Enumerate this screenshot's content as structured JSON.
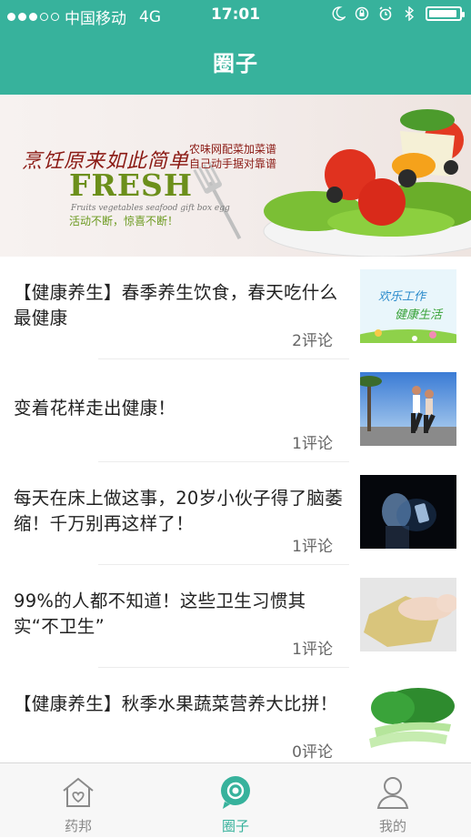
{
  "status_bar": {
    "carrier": "中国移动",
    "network": "4G",
    "time": "17:01",
    "signal_filled": 3,
    "signal_total": 5,
    "battery_level": 0.95,
    "icons": [
      "moon-icon",
      "orientation-lock-icon",
      "alarm-icon",
      "bluetooth-icon",
      "battery-icon"
    ]
  },
  "nav": {
    "title": "圈子"
  },
  "banner": {
    "slogan": "烹饪原来如此简单",
    "side_line1": "农味网配菜加菜谱",
    "side_line2": "自己动手据对靠谱",
    "fresh": "FRESH",
    "sub": "Fruits  vegetables  seafood  gift box egg",
    "tagline": "活动不断，惊喜不断！"
  },
  "posts": [
    {
      "title": "【健康养生】春季养生饮食，春天吃什么最健康",
      "comments": "2评论",
      "thumb": "spring-banner",
      "thumb_text1": "欢乐工作",
      "thumb_text2": "健康生活"
    },
    {
      "title": "变着花样走出健康！",
      "comments": "1评论",
      "thumb": "runners-photo"
    },
    {
      "title": "每天在床上做这事，20岁小伙子得了脑萎缩！千万别再这样了！",
      "comments": "1评论",
      "thumb": "phone-in-dark-photo"
    },
    {
      "title": "99%的人都不知道！这些卫生习惯其实“不卫生”",
      "comments": "1评论",
      "thumb": "cleaning-cloth-photo"
    },
    {
      "title": "【健康养生】秋季水果蔬菜营养大比拼！",
      "comments": "0评论",
      "thumb": "bok-choy-photo"
    }
  ],
  "tabs": [
    {
      "label": "药邦",
      "icon": "home-heart-icon",
      "active": false
    },
    {
      "label": "圈子",
      "icon": "circle-chat-icon",
      "active": true
    },
    {
      "label": "我的",
      "icon": "user-icon",
      "active": false
    }
  ],
  "colors": {
    "accent": "#37b29c",
    "tab_inactive": "#888888",
    "comment_text": "#666666"
  }
}
